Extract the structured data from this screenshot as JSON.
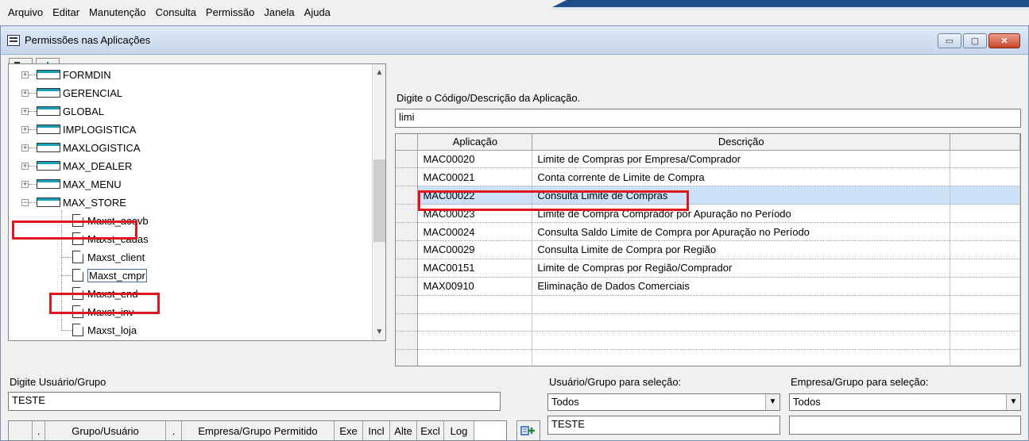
{
  "menu": [
    "Arquivo",
    "Editar",
    "Manutenção",
    "Consulta",
    "Permissão",
    "Janela",
    "Ajuda"
  ],
  "window": {
    "title": "Permissões nas Aplicações",
    "controls": {
      "minimize": "▭",
      "maximize": "▢",
      "close": "✕"
    }
  },
  "toolbar": {
    "buttons": [
      {
        "name": "exit-icon"
      },
      {
        "name": "save-icon"
      }
    ]
  },
  "tree": {
    "top_items": [
      "FORMDIN",
      "GERENCIAL",
      "GLOBAL",
      "IMPLOGISTICA",
      "MAXLOGISTICA",
      "MAX_DEALER",
      "MAX_MENU",
      "MAX_STORE"
    ],
    "expand_glyph": "+",
    "collapse_glyph": "−",
    "children": [
      "Maxst_acovb",
      "Maxst_cadas",
      "Maxst_client",
      "Maxst_cmpr",
      "Maxst_end",
      "Maxst_inv",
      "Maxst_loja"
    ]
  },
  "search": {
    "label": "Digite o Código/Descrição da Aplicação.",
    "value": "limi"
  },
  "grid": {
    "columns": [
      "Aplicação",
      "Descrição"
    ],
    "rows": [
      {
        "app": "MAC00020",
        "desc": "Limite de Compras por Empresa/Comprador"
      },
      {
        "app": "MAC00021",
        "desc": "Conta corrente de Limite de Compra"
      },
      {
        "app": "MAC00022",
        "desc": "Consulta Limite de Compras"
      },
      {
        "app": "MAC00023",
        "desc": "Limite de Compra Comprador por Apuração no Período"
      },
      {
        "app": "MAC00024",
        "desc": "Consulta Saldo Limite de Compra por Apuração no Período"
      },
      {
        "app": "MAC00029",
        "desc": "Consulta Limite de Compra por Região"
      },
      {
        "app": "MAC00151",
        "desc": "Limite de Compras por Região/Comprador"
      },
      {
        "app": "MAX00910",
        "desc": "Eliminação de Dados Comerciais"
      },
      {
        "app": "",
        "desc": ""
      },
      {
        "app": "",
        "desc": ""
      },
      {
        "app": "",
        "desc": ""
      },
      {
        "app": "",
        "desc": ""
      }
    ]
  },
  "user": {
    "label": "Digite Usuário/Grupo",
    "value": "TESTE"
  },
  "user_group_select": {
    "label": "Usuário/Grupo para seleção:",
    "selected": "Todos",
    "text_value": "TESTE"
  },
  "company_group_select": {
    "label": "Empresa/Grupo para seleção:",
    "selected": "Todos",
    "text_value": ""
  },
  "permissions_grid": {
    "columns": [
      ".",
      "Grupo/Usuário",
      ".",
      "Empresa/Grupo Permitido",
      "Exe",
      "Incl",
      "Alte",
      "Excl",
      "Log"
    ]
  },
  "colors": {
    "highlight": "#e0161e",
    "selected_row": "#cce0f7",
    "title_bar": "#c6d6ea"
  }
}
